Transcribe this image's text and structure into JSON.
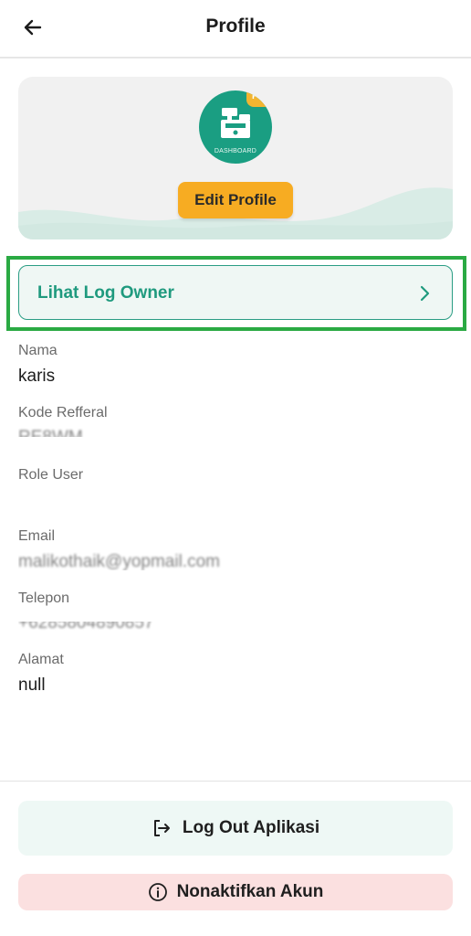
{
  "header": {
    "title": "Profile",
    "back_icon": "arrow-left-icon"
  },
  "profile_card": {
    "avatar_badge": "PR",
    "avatar_label": "DASHBOARD",
    "avatar_icon": "cash-register-icon",
    "edit_button_label": "Edit Profile"
  },
  "log_owner": {
    "label": "Lihat Log Owner",
    "icon": "chevron-right-icon"
  },
  "fields": {
    "nama": {
      "label": "Nama",
      "value": "karis"
    },
    "kode_refferal": {
      "label": "Kode Refferal",
      "value": "RE8WM"
    },
    "role_user": {
      "label": "Role User",
      "value": ""
    },
    "email": {
      "label": "Email",
      "value": "malikothaik@yopmail.com"
    },
    "telepon": {
      "label": "Telepon",
      "value": "+6285804890857"
    },
    "alamat": {
      "label": "Alamat",
      "value": "null"
    }
  },
  "actions": {
    "logout_label": "Log Out Aplikasi",
    "logout_icon": "logout-icon",
    "deactivate_label": "Nonaktifkan Akun",
    "deactivate_icon": "info-circle-icon"
  },
  "colors": {
    "primary": "#1f9a7e",
    "accent": "#f7ac22",
    "highlight": "#2aaa43",
    "danger_bg": "#fbe0e0"
  }
}
